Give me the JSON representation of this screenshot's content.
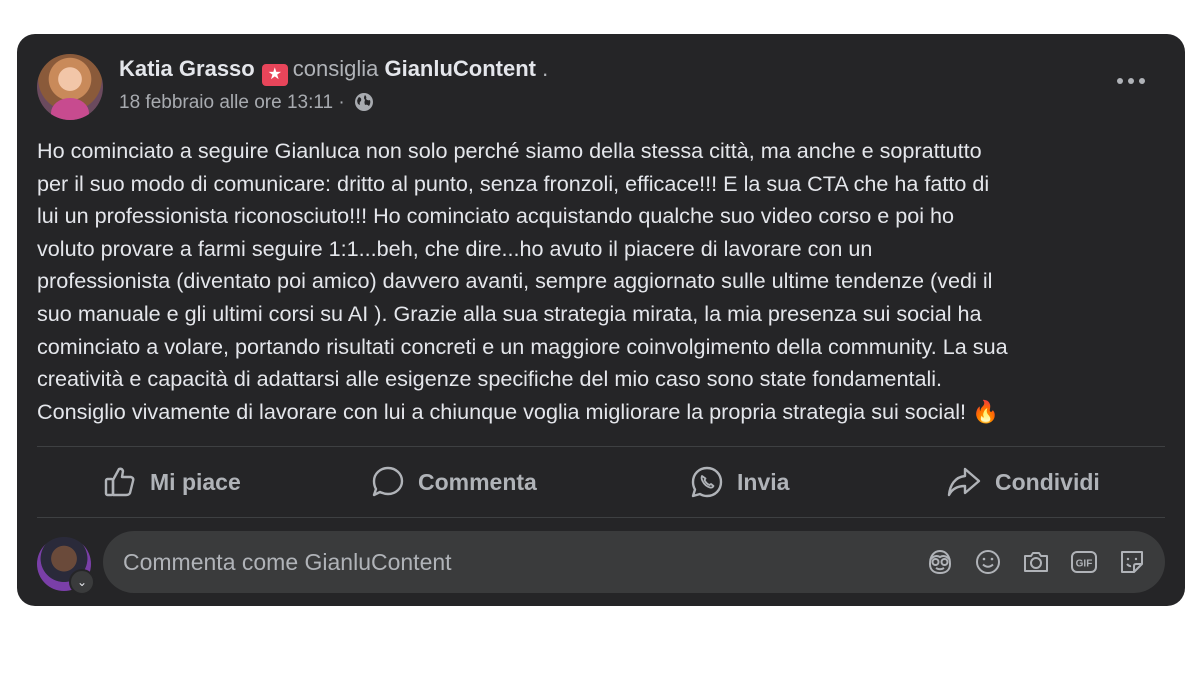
{
  "post": {
    "author": "Katia Grasso",
    "badge_icon": "star-badge-icon",
    "verb": "consiglia",
    "page": "GianluContent",
    "page_suffix": ".",
    "timestamp": "18 febbraio alle ore 13:11",
    "separator": "·",
    "privacy_icon": "globe-icon",
    "body_lines": [
      "Ho cominciato a seguire Gianluca non solo perché siamo della stessa città, ma anche e soprattutto",
      "per il suo modo di comunicare: dritto al punto, senza fronzoli, efficace!!! E la sua CTA che ha fatto di",
      "lui un professionista riconosciuto!!! Ho cominciato acquistando qualche suo video corso e poi ho",
      "voluto provare a farmi seguire 1:1...beh, che dire...ho  avuto il  piacere di lavorare con un",
      "professionista (diventato poi amico) davvero avanti, sempre aggiornato sulle ultime tendenze (vedi il",
      "suo manuale e gli ultimi corsi su AI ). Grazie alla sua strategia mirata, la mia presenza sui social ha",
      "cominciato a volare, portando risultati concreti e un maggiore coinvolgimento della community. La sua",
      "creatività e capacità di adattarsi alle esigenze specifiche del mio caso sono state fondamentali.",
      "Consiglio vivamente di lavorare con lui a chiunque voglia migliorare la propria strategia sui social! 🔥"
    ]
  },
  "actions": {
    "like": "Mi piace",
    "comment": "Commenta",
    "send": "Invia",
    "share": "Condividi"
  },
  "composer": {
    "placeholder": "Commenta come GianluContent",
    "icons": [
      "avatar-sticker-icon",
      "emoji-icon",
      "camera-icon",
      "gif-icon",
      "sticker-icon"
    ]
  },
  "colors": {
    "card_bg": "#252527",
    "text_primary": "#e4e6eb",
    "text_secondary": "#b0b3b8",
    "input_bg": "#3a3b3c",
    "divider": "#3e4042",
    "badge": "#e8455a"
  }
}
